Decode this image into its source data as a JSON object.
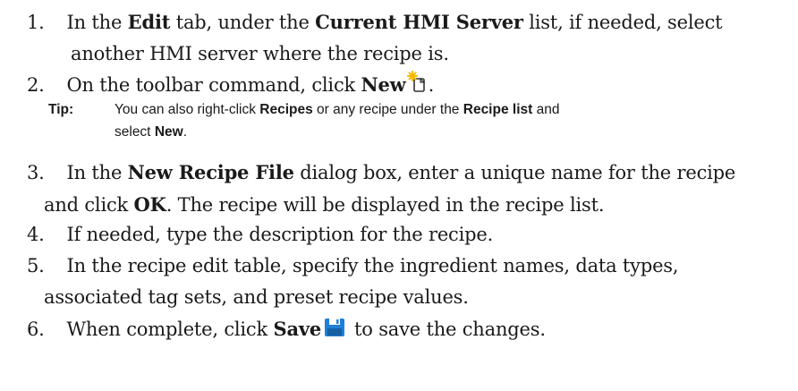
{
  "steps": [
    {
      "number": "1.",
      "parts": [
        "In the ",
        "Edit",
        " tab, under the ",
        "Current HMI Server",
        " list, if needed, select"
      ],
      "continuation": "another HMI server where the recipe is."
    },
    {
      "number": "2.",
      "parts": [
        "On the toolbar command, click ",
        "New",
        "."
      ],
      "icon": "new-recipe-icon"
    },
    {
      "number": "3.",
      "parts": [
        "In the ",
        "New Recipe File",
        " dialog box, enter a unique name for the recipe"
      ],
      "continuation_parts": [
        "and click ",
        "OK",
        ". The recipe will be displayed in the recipe list."
      ]
    },
    {
      "number": "4.",
      "text": "If needed, type the description for the recipe."
    },
    {
      "number": "5.",
      "text": "In the recipe edit table, specify the ingredient names, data types,",
      "continuation": "associated tag sets, and preset recipe values."
    },
    {
      "number": "6.",
      "parts": [
        "When complete, click ",
        "Save",
        "to save the changes."
      ],
      "icon": "save-icon"
    }
  ],
  "tip": {
    "label": "Tip:",
    "parts": [
      "You can also right-click ",
      "Recipes",
      " or any recipe under the ",
      "Recipe list",
      " and"
    ],
    "continuation_parts": [
      "select ",
      "New",
      "."
    ]
  },
  "colors": {
    "text": "#1a1a1a",
    "new_icon_star": "#f5b800",
    "save_icon": "#1f7fd6"
  }
}
